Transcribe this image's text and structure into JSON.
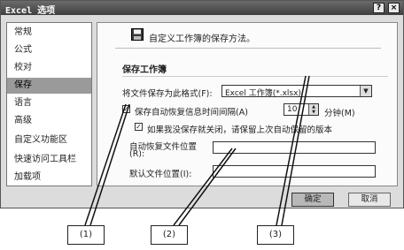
{
  "window": {
    "title": "Excel 选项",
    "help_label": "?",
    "close_label": "×"
  },
  "sidebar": {
    "items": [
      {
        "label": "常规"
      },
      {
        "label": "公式"
      },
      {
        "label": "校对"
      },
      {
        "label": "保存",
        "selected": true
      },
      {
        "label": "语言"
      },
      {
        "label": "高级"
      },
      {
        "label": "自定义功能区"
      },
      {
        "label": "快速访问工具栏"
      },
      {
        "label": "加载项"
      }
    ]
  },
  "main": {
    "header_icon": "save-icon",
    "header_text": "自定义工作簿的保存方法。",
    "section_title": "保存工作簿",
    "save_format_label": "将文件保存为此格式(F):",
    "save_format_value": "Excel 工作簿(*.xlsx)",
    "autorecover_label": "保存自动恢复信息时间间隔(A)",
    "autorecover_checked": true,
    "autorecover_minutes": "10",
    "minutes_unit": "分钟(M)",
    "keep_last_label": "如果我没保存就关闭，请保留上次自动保留的版本",
    "keep_last_checked": true,
    "autorecover_location_label": "自动恢复文件位置\n(R):",
    "autorecover_location_label_line1": "自动恢复文件位置",
    "autorecover_location_label_line2": "(R):",
    "autorecover_location_value": "",
    "default_location_label": "默认文件位置(I):",
    "default_location_value": ""
  },
  "footer": {
    "ok_label": "确定",
    "cancel_label": "取消"
  },
  "callouts": [
    "(1)",
    "(2)",
    "(3)"
  ]
}
